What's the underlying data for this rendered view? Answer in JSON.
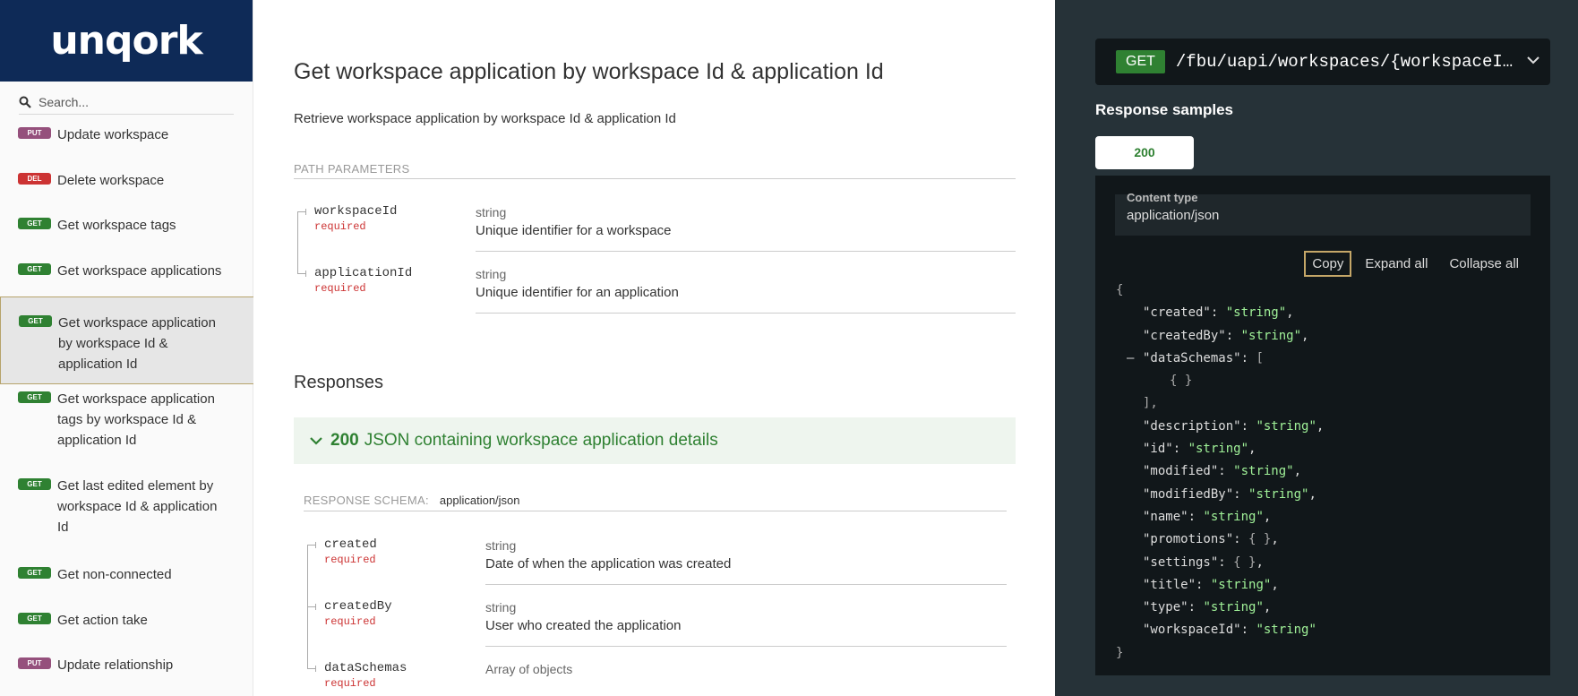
{
  "logo": {
    "text": "unqork"
  },
  "sidebar": {
    "search_placeholder": "Search...",
    "items": [
      {
        "method": "PUT",
        "label": "Update workspace"
      },
      {
        "method": "DEL",
        "label": "Delete workspace"
      },
      {
        "method": "GET",
        "label": "Get workspace tags"
      },
      {
        "method": "GET",
        "label": "Get workspace applications"
      },
      {
        "method": "GET",
        "label_lines": [
          "Get workspace application",
          "by workspace Id &",
          "application Id"
        ],
        "active": true
      },
      {
        "method": "GET",
        "label_lines": [
          "Get workspace application",
          "tags by workspace Id &",
          "application Id"
        ]
      },
      {
        "method": "GET",
        "label_lines": [
          "Get last edited element by",
          "workspace Id & application",
          "Id"
        ]
      },
      {
        "method": "GET",
        "label": "Get non-connected"
      },
      {
        "method": "GET",
        "label": "Get action take"
      },
      {
        "method": "PUT",
        "label": "Update relationship"
      }
    ]
  },
  "main": {
    "title": "Get workspace application by workspace Id & application Id",
    "description": "Retrieve workspace application by workspace Id & application Id",
    "path_parameters_header": "PATH PARAMETERS",
    "path_parameters": [
      {
        "name": "workspaceId",
        "required": "required",
        "type": "string",
        "description": "Unique identifier for a workspace"
      },
      {
        "name": "applicationId",
        "required": "required",
        "type": "string",
        "description": "Unique identifier for an application"
      }
    ],
    "responses_title": "Responses",
    "response_200": {
      "code": "200",
      "text": "JSON containing workspace application details"
    },
    "response_schema_label": "RESPONSE SCHEMA:",
    "response_schema_value": "application/json",
    "schema_fields": [
      {
        "name": "created",
        "required": "required",
        "type": "string",
        "description": "Date of when the application was created"
      },
      {
        "name": "createdBy",
        "required": "required",
        "type": "string",
        "description": "User who created the application"
      },
      {
        "name": "dataSchemas",
        "required": "required",
        "type": "Array of objects",
        "description": ""
      }
    ]
  },
  "right": {
    "method": "GET",
    "path": "/fbu/uapi/workspaces/{workspaceI…",
    "response_samples_title": "Response samples",
    "tab_label": "200",
    "content_type_label": "Content type",
    "content_type_value": "application/json",
    "copy_label": "Copy",
    "expand_label": "Expand all",
    "collapse_label": "Collapse all",
    "json_lines": [
      {
        "text": "{",
        "indent": 0
      },
      {
        "key": "\"created\"",
        "value": "\"string\"",
        "indent": 1
      },
      {
        "key": "\"createdBy\"",
        "value": "\"string\"",
        "indent": 1
      },
      {
        "key": "\"dataSchemas\"",
        "open": "[",
        "indent": 1,
        "collapser": "–"
      },
      {
        "text": "{ }",
        "indent": 2
      },
      {
        "text": "],",
        "indent": 1
      },
      {
        "key": "\"description\"",
        "value": "\"string\"",
        "indent": 1
      },
      {
        "key": "\"id\"",
        "value": "\"string\"",
        "indent": 1
      },
      {
        "key": "\"modified\"",
        "value": "\"string\"",
        "indent": 1
      },
      {
        "key": "\"modifiedBy\"",
        "value": "\"string\"",
        "indent": 1
      },
      {
        "key": "\"name\"",
        "value": "\"string\"",
        "indent": 1
      },
      {
        "key": "\"promotions\"",
        "raw": "{ }",
        "indent": 1
      },
      {
        "key": "\"settings\"",
        "raw": "{ }",
        "indent": 1
      },
      {
        "key": "\"title\"",
        "value": "\"string\"",
        "indent": 1
      },
      {
        "key": "\"type\"",
        "value": "\"string\"",
        "indent": 1
      },
      {
        "key": "\"workspaceId\"",
        "value": "\"string\"",
        "indent": 1,
        "last": true
      },
      {
        "text": "}",
        "indent": 0
      }
    ]
  },
  "colors": {
    "get": "#2f8132",
    "put": "#95507c",
    "del": "#cc3333",
    "logo_bg": "#0e2a57",
    "panel_bg": "#263238",
    "code_bg": "#11171a",
    "json_string": "#a0f198"
  },
  "icons": {
    "search": "search-icon",
    "chevron": "chevron-down-icon"
  }
}
